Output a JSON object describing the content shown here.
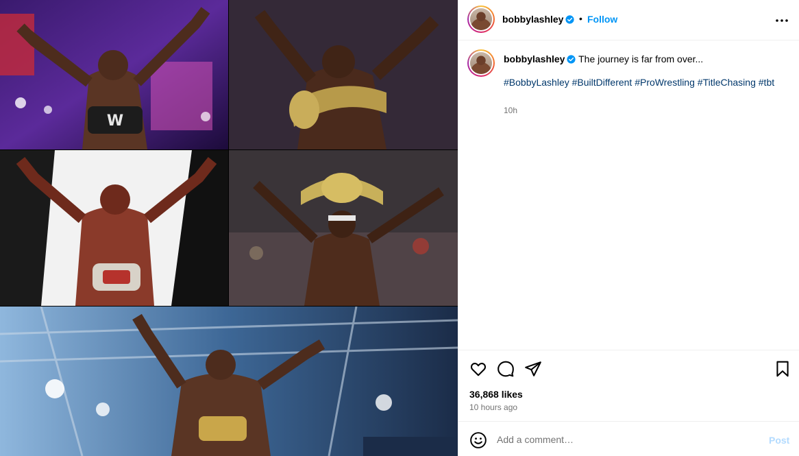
{
  "post": {
    "username": "bobbylashley",
    "verified": true,
    "follow_label": "Follow",
    "separator": "•",
    "caption": "The journey is far from over...",
    "hashtags": [
      "#BobbyLashley",
      "#BuiltDifferent",
      "#ProWrestling",
      "#TitleChasing",
      "#tbt"
    ],
    "caption_time": "10h",
    "likes": "36,868 likes",
    "time_ago": "10 hours ago"
  },
  "comment": {
    "placeholder": "Add a comment…",
    "post_label": "Post"
  },
  "icons": {
    "more": "more-options-icon",
    "like": "heart-icon",
    "comment": "comment-icon",
    "share": "share-icon",
    "save": "bookmark-icon",
    "emoji": "emoji-icon",
    "verified": "verified-badge-icon"
  },
  "colors": {
    "accent": "#0095f6",
    "hashtag": "#00376b",
    "muted": "#737373",
    "post_disabled": "#b3dbff"
  }
}
